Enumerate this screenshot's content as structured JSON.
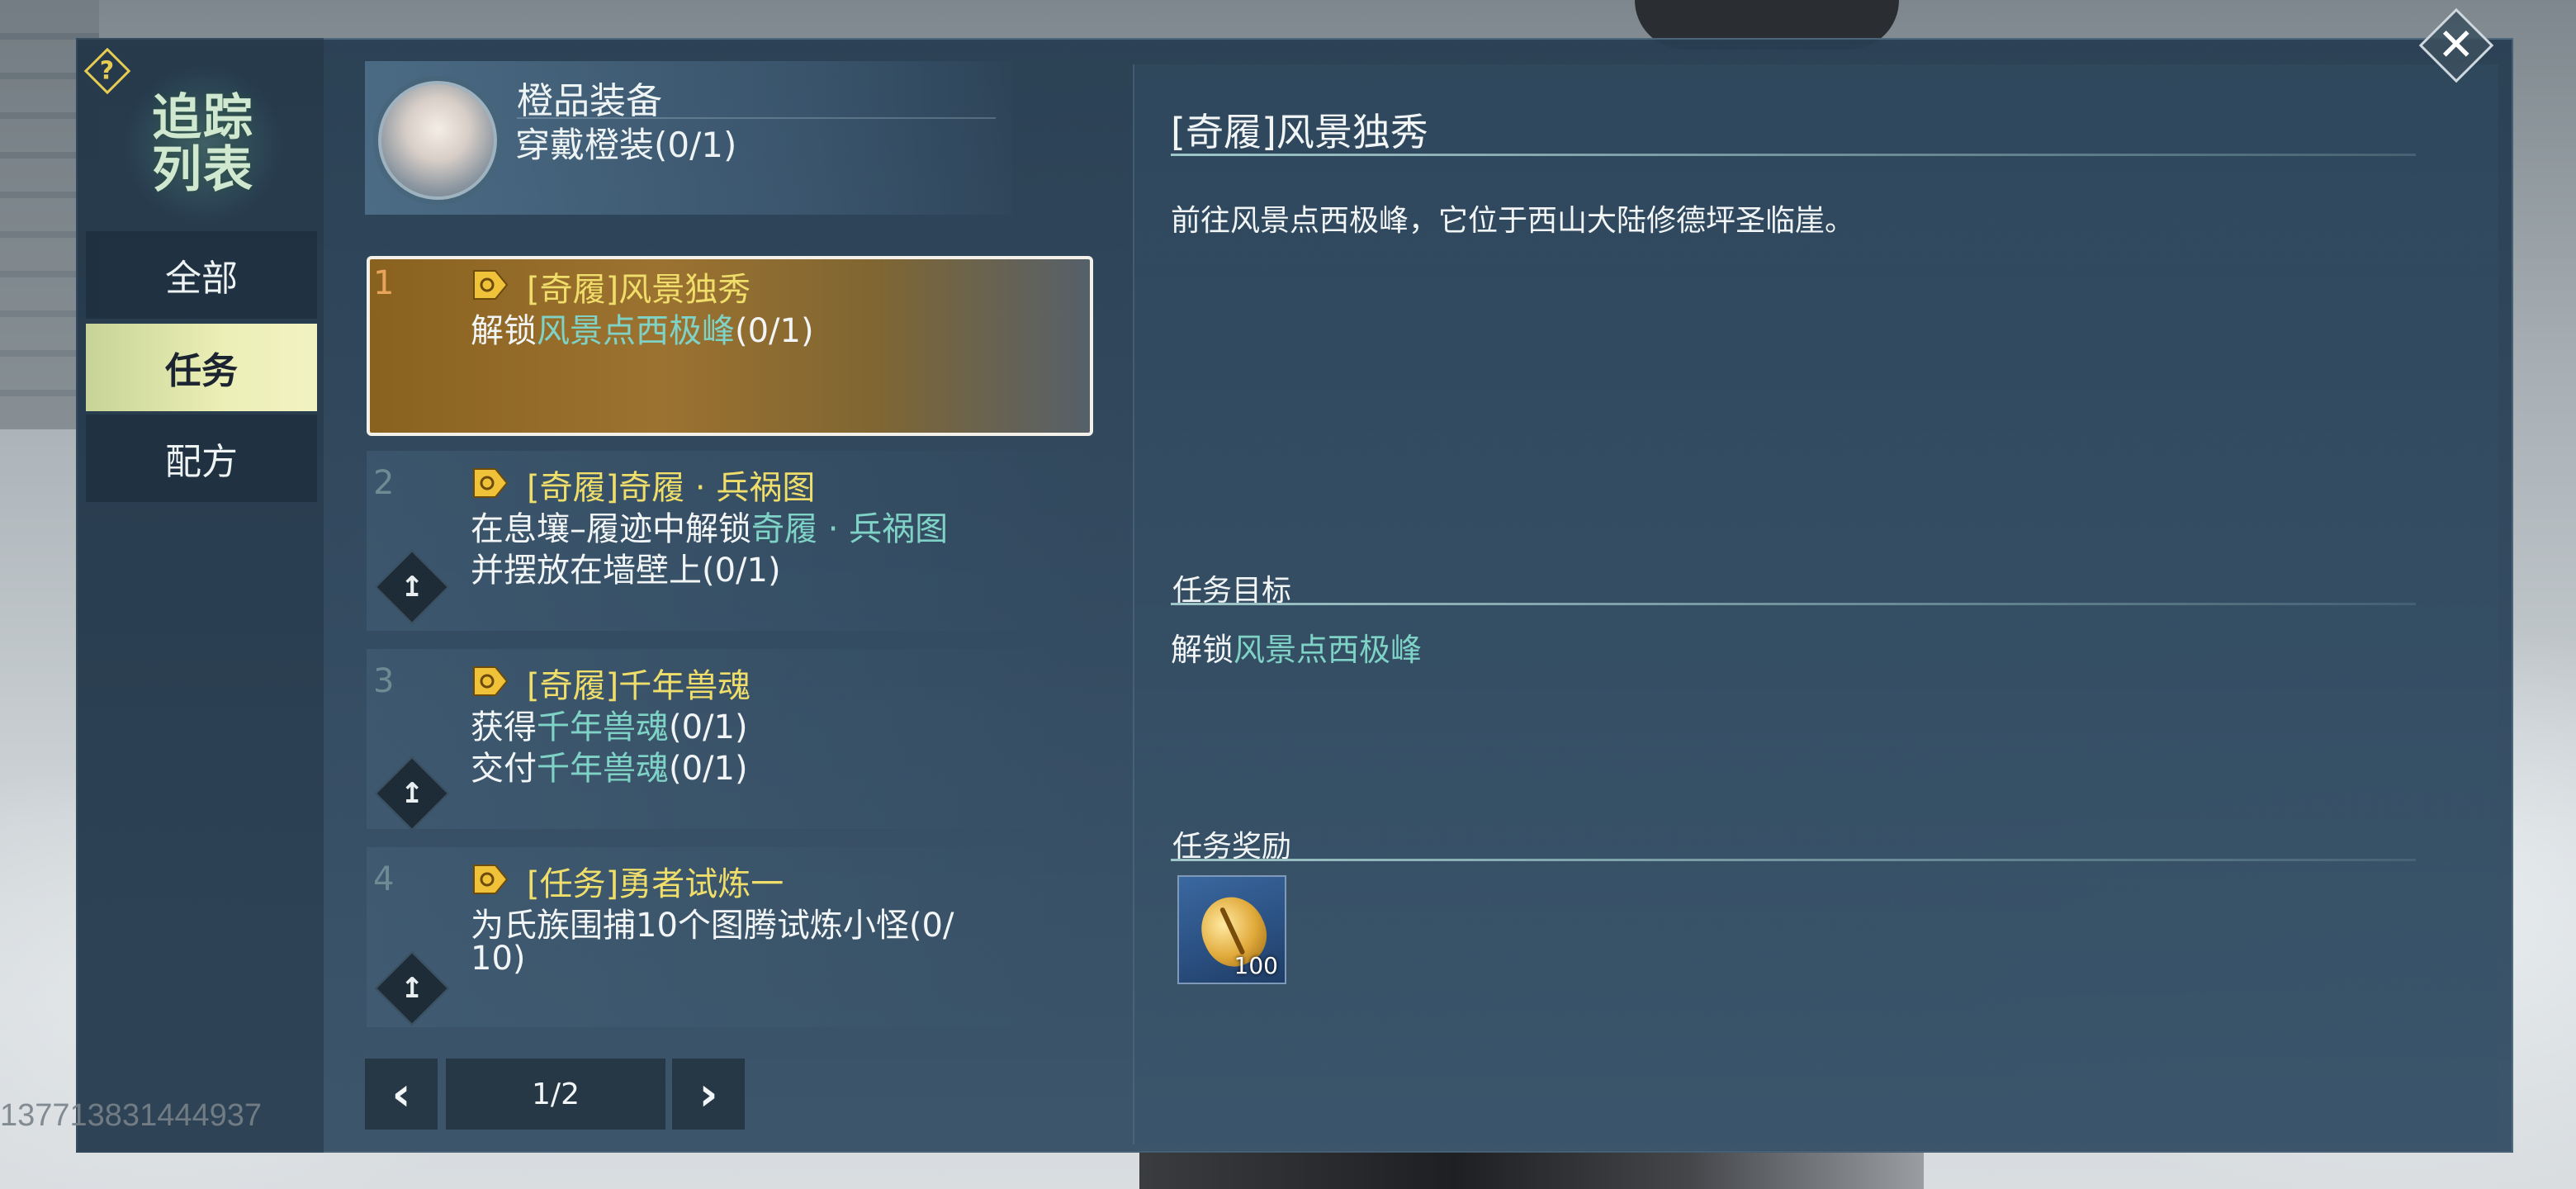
{
  "sidebar": {
    "help_label": "?",
    "title_line1": "追踪",
    "title_line2": "列表",
    "items": [
      {
        "label": "全部",
        "active": false
      },
      {
        "label": "任务",
        "active": true
      },
      {
        "label": "配方",
        "active": false
      }
    ]
  },
  "equip": {
    "title": "橙品装备",
    "subtitle": "穿戴橙装(0/1)"
  },
  "quests": [
    {
      "num": "1",
      "title": "[奇履]风景独秀",
      "line1_prefix": "解锁",
      "line1_highlight": "风景点西极峰",
      "line1_suffix": "(0/1)"
    },
    {
      "num": "2",
      "title": "[奇履]奇履 · 兵祸图",
      "line1_prefix": "在息壤–履迹中解锁",
      "line1_highlight": "奇履 · 兵祸图",
      "line2": "并摆放在墙壁上(0/1)",
      "pin_icon": "↥"
    },
    {
      "num": "3",
      "title": "[奇履]千年兽魂",
      "line1_prefix": "获得",
      "line1_highlight": "千年兽魂",
      "line1_suffix": "(0/1)",
      "line2_prefix": "交付",
      "line2_highlight": "千年兽魂",
      "line2_suffix": "(0/1)",
      "pin_icon": "↥"
    },
    {
      "num": "4",
      "title": "[任务]勇者试炼一",
      "line1": "为氏族围捕10个图腾试炼小怪(0/",
      "line2": "10)",
      "pin_icon": "↥"
    }
  ],
  "pager": {
    "prev": "‹",
    "text": "1/2",
    "next": "›"
  },
  "detail": {
    "title": "[奇履]风景独秀",
    "description": "前往风景点西极峰，它位于西山大陆修德坪圣临崖。",
    "objective_header": "任务目标",
    "objective_prefix": "解锁",
    "objective_highlight": "风景点西极峰",
    "reward_header": "任务奖励",
    "reward_count": "100"
  },
  "close_label": "✕",
  "watermark": "13771383144493​7",
  "colors": {
    "accent_gold": "#f0de6a",
    "highlight_teal": "#7fd3c6",
    "active_tab": "#ecefb6"
  }
}
